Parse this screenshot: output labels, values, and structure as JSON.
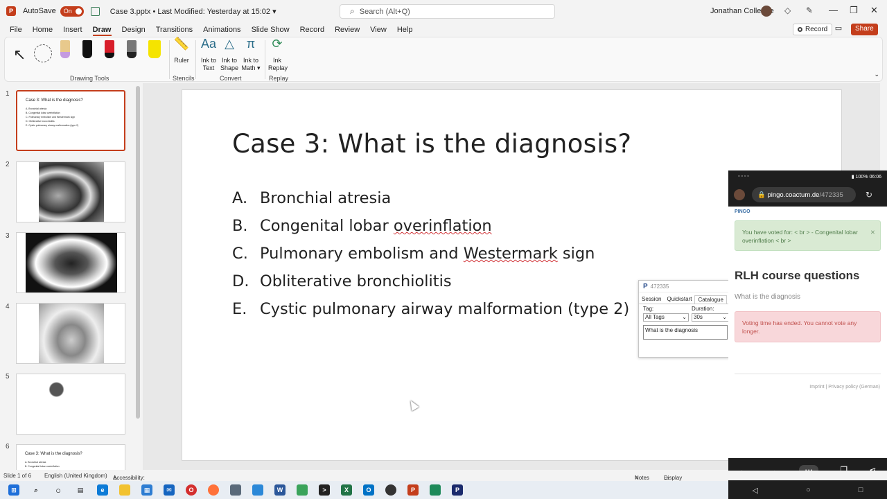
{
  "titlebar": {
    "autosave_label": "AutoSave",
    "autosave_state": "On",
    "doc_title": "Case 3.pptx • Last Modified: Yesterday at 15:02 ▾",
    "search_placeholder": "Search (Alt+Q)",
    "user_name": "Jonathan Colledge"
  },
  "tabs": [
    "File",
    "Home",
    "Insert",
    "Draw",
    "Design",
    "Transitions",
    "Animations",
    "Slide Show",
    "Record",
    "Review",
    "View",
    "Help"
  ],
  "active_tab": "Draw",
  "top_actions": {
    "record": "Record",
    "share": "Share"
  },
  "ribbon": {
    "drawing_tools_label": "Drawing Tools",
    "stencils_label": "Stencils",
    "convert_label": "Convert",
    "replay_label": "Replay",
    "ruler": "Ruler",
    "ink_to_text": "Ink to Text",
    "ink_to_shape": "Ink to Shape",
    "ink_to_math": "Ink to Math ▾",
    "ink_replay": "Ink Replay"
  },
  "thumbnails": [
    {
      "num": "1",
      "title": "Case 3: What is the diagnosis?",
      "lines": [
        "A.   Bronchial atresia",
        "B.   Congenital lobar overinflation",
        "C.   Pulmonary embolism and Westermark sign",
        "D.   Obliterative bronchiolitis",
        "E.   Cystic pulmonary airway malformation (type 2)"
      ]
    },
    {
      "num": "2"
    },
    {
      "num": "3"
    },
    {
      "num": "4"
    },
    {
      "num": "5"
    },
    {
      "num": "6",
      "title": "Case 3: What is the diagnosis?",
      "lines": [
        "A.   Bronchial atresia",
        "B.   Congenital lobar overinflation"
      ]
    }
  ],
  "slide": {
    "title": "Case 3: What is the diagnosis?",
    "options": [
      {
        "letter": "A.",
        "text": "Bronchial atresia"
      },
      {
        "letter": "B.",
        "text_before": "Congenital lobar ",
        "text_squiggle": "overinflation",
        "text_after": ""
      },
      {
        "letter": "C.",
        "text_before": "Pulmonary embolism and ",
        "text_squiggle": "Westermark",
        "text_after": " sign"
      },
      {
        "letter": "D.",
        "text": "Obliterative bronchiolitis"
      },
      {
        "letter": "E.",
        "text": "Cystic pulmonary airway malformation (type 2)"
      }
    ]
  },
  "pingo_popup": {
    "code": "472335",
    "tabs": [
      "Session",
      "Quickstart",
      "Catalogue"
    ],
    "tag_label": "Tag:",
    "tag_value": "All Tags",
    "duration_label": "Duration:",
    "duration_value": "30s",
    "question": "What is the diagnosis"
  },
  "phone": {
    "status_right": "100% 06:06",
    "url_domain": "pingo.coactum.de",
    "url_path": "/472335",
    "brand": "PINGO",
    "vote_confirmation": "You have voted for: < br > - Congenital lobar overinflation < br >",
    "session_title": "RLH course questions",
    "question": "What is the diagnosis",
    "ended_message": "Voting time has ended. You cannot vote any longer.",
    "footer": "Imprint | Privacy policy (German)"
  },
  "statusbar": {
    "slide_pos": "Slide 1 of 6",
    "language": "English (United Kingdom)",
    "accessibility": "Accessibility: Investigate",
    "notes": "Notes",
    "display_settings": "Display Settings"
  },
  "colors": {
    "accent": "#c43e1c",
    "vote_ok_bg": "#d9ead3",
    "vote_ended_bg": "#f8d7da"
  }
}
